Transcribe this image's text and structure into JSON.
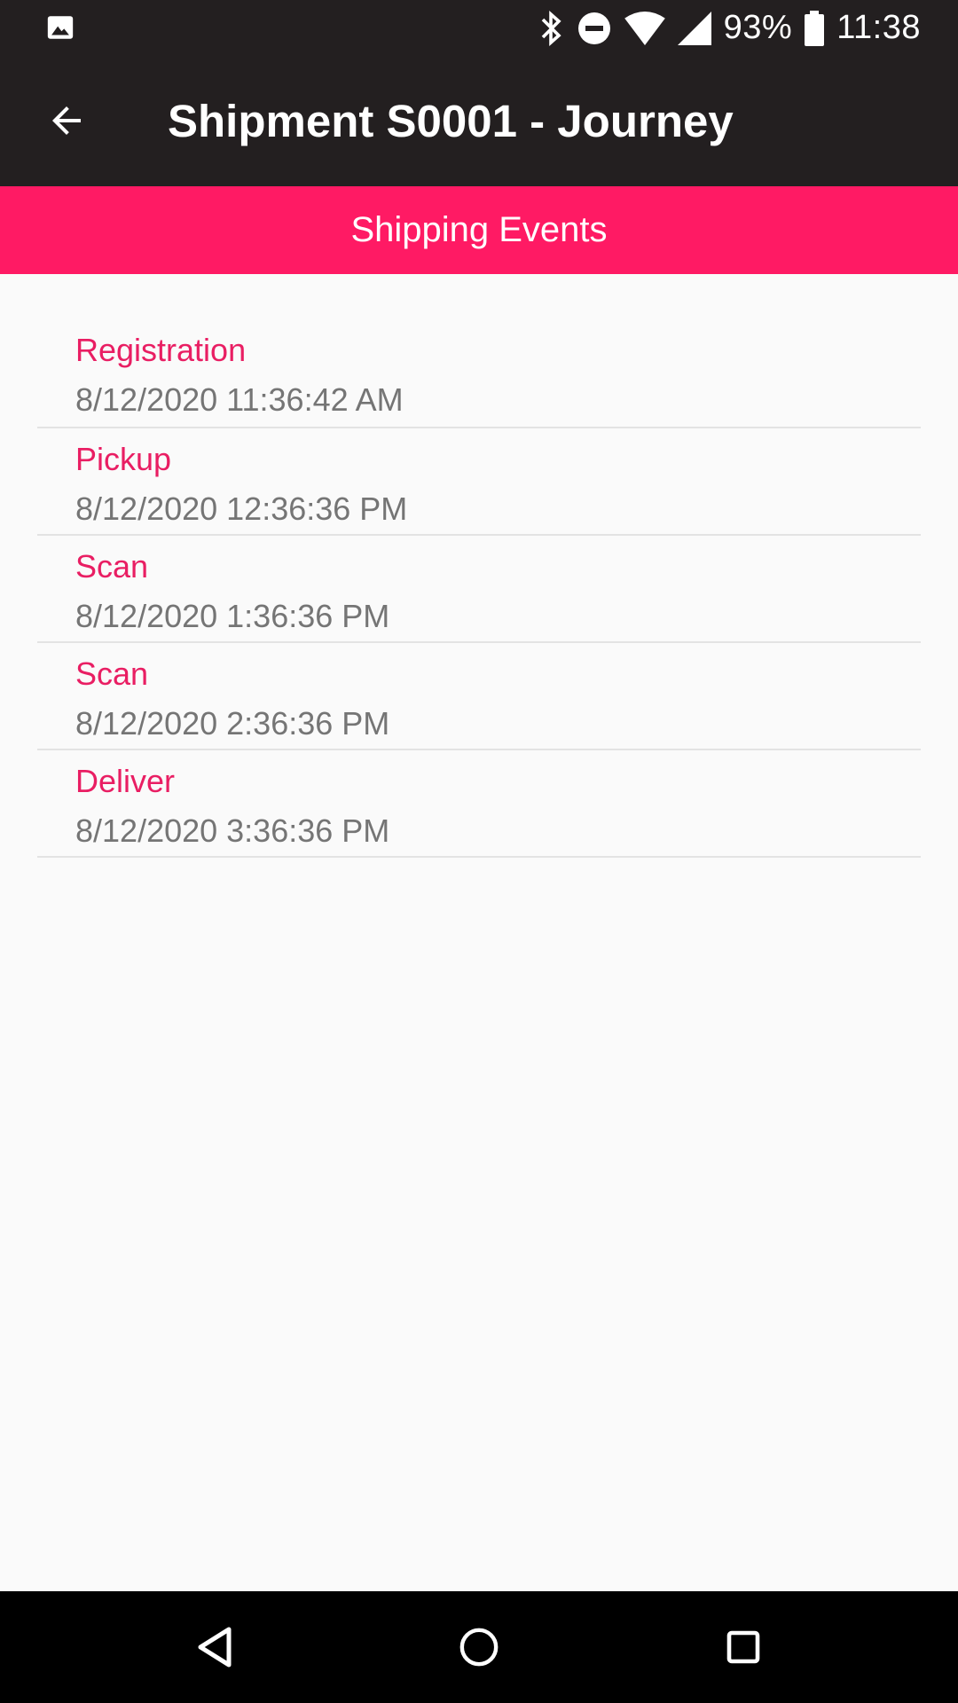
{
  "status_bar": {
    "left_icon": "image-icon",
    "battery_percent": "93%",
    "time": "11:38",
    "icons": [
      "bluetooth-icon",
      "do-not-disturb-icon",
      "wifi-icon",
      "cellular-signal-icon",
      "battery-icon"
    ]
  },
  "app_bar": {
    "title": "Shipment S0001 - Journey",
    "back_icon": "arrow-back-icon"
  },
  "tab_header": {
    "label": "Shipping Events"
  },
  "events": [
    {
      "name": "Registration",
      "time": "8/12/2020 11:36:42 AM"
    },
    {
      "name": "Pickup",
      "time": "8/12/2020 12:36:36 PM"
    },
    {
      "name": "Scan",
      "time": "8/12/2020 1:36:36 PM"
    },
    {
      "name": "Scan",
      "time": "8/12/2020 2:36:36 PM"
    },
    {
      "name": "Deliver",
      "time": "8/12/2020 3:36:36 PM"
    }
  ],
  "nav_bar": {
    "icons": [
      "back-triangle-icon",
      "home-circle-icon",
      "recents-square-icon"
    ]
  },
  "colors": {
    "app_bar": "#231f20",
    "accent": "#ff1a64",
    "event_name": "#e91e63",
    "event_time": "#757575",
    "background": "#fafafa"
  }
}
